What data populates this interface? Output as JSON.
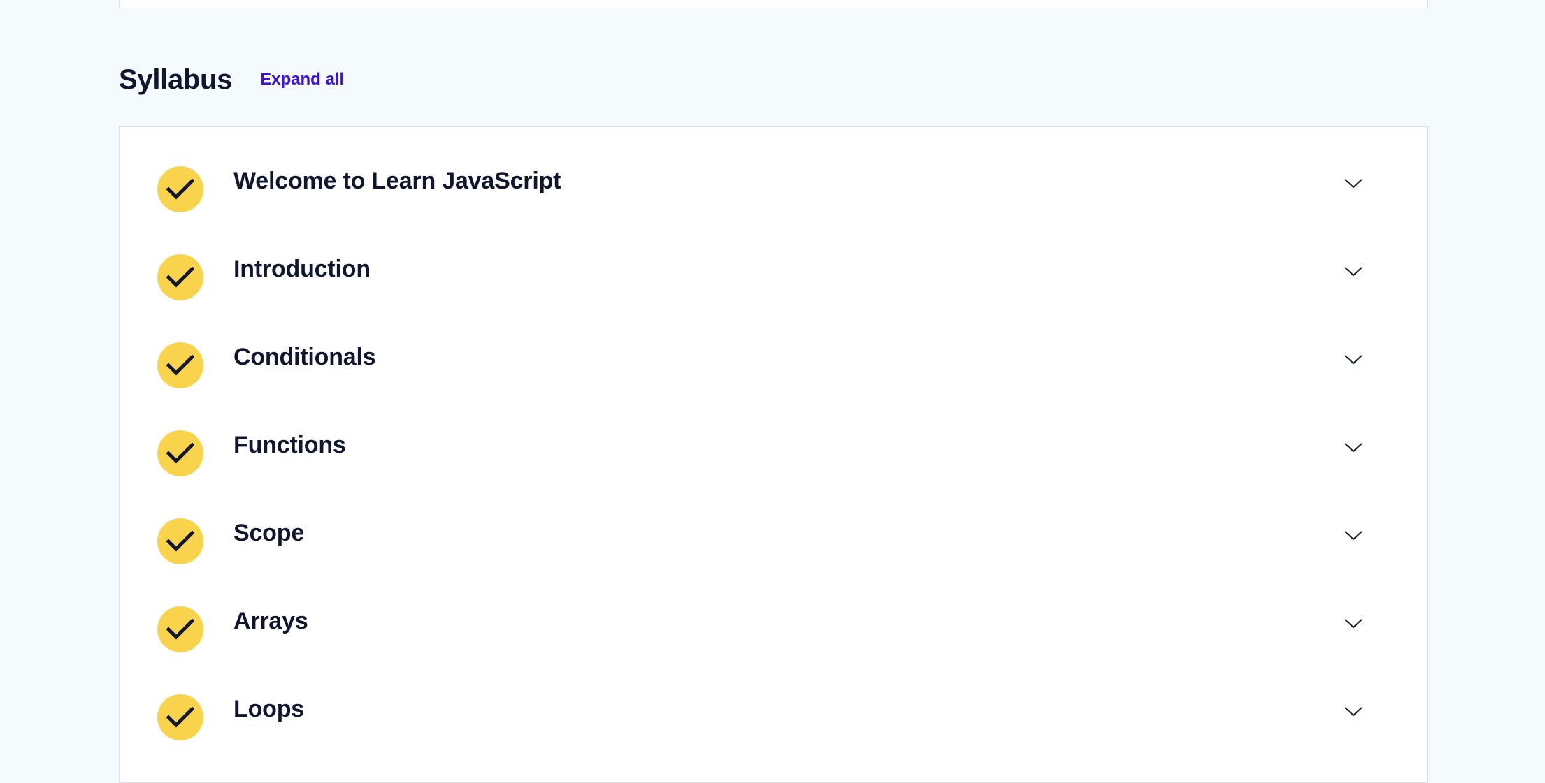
{
  "syllabus": {
    "title": "Syllabus",
    "expand_all_label": "Expand all",
    "modules": [
      {
        "title": "Welcome to Learn JavaScript",
        "completed": true
      },
      {
        "title": "Introduction",
        "completed": true
      },
      {
        "title": "Conditionals",
        "completed": true
      },
      {
        "title": "Functions",
        "completed": true
      },
      {
        "title": "Scope",
        "completed": true
      },
      {
        "title": "Arrays",
        "completed": true
      },
      {
        "title": "Loops",
        "completed": true
      }
    ]
  },
  "colors": {
    "background": "#f5fafd",
    "card": "#ffffff",
    "text": "#10162f",
    "link": "#3a10e5",
    "check_badge": "#f9d34c"
  },
  "icons": {
    "check": "checkmark-icon",
    "expand": "chevron-down-icon"
  }
}
